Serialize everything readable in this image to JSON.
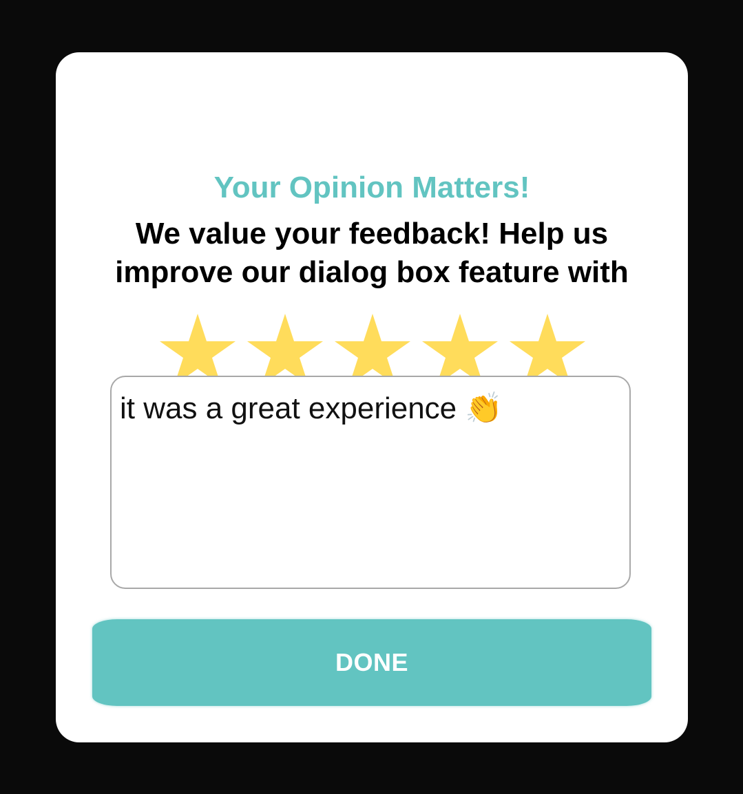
{
  "dialog": {
    "title": "Your Opinion Matters!",
    "message": "We value your feedback! Help us improve our dialog box feature with",
    "rating": {
      "value": 5,
      "max": 5,
      "star_color": "#FFDC5B"
    },
    "feedback_value": "it was a great experience 👏",
    "done_label": "DONE"
  },
  "colors": {
    "accent": "#62C4C1",
    "background": "#0A0A0A",
    "dialog_background": "#FFFFFF"
  }
}
